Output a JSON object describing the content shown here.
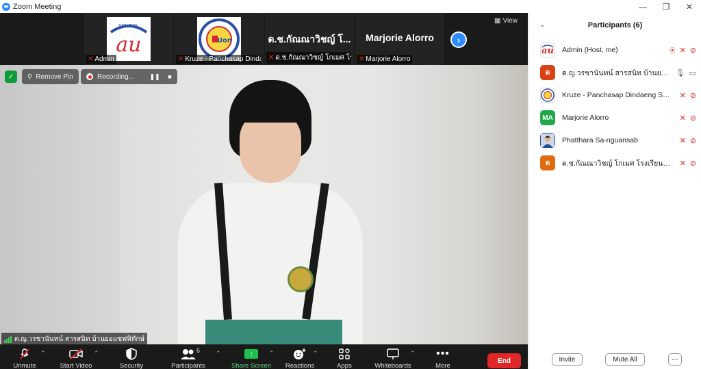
{
  "window": {
    "title": "Zoom Meeting",
    "controls": [
      "—",
      "❐",
      "✕"
    ]
  },
  "strip": {
    "thumbnails": [
      {
        "name": "Admin",
        "logo": "school-logo-au"
      },
      {
        "name": "Kruze - Panchasap Dindaeng School",
        "logo": "school-logo-circle"
      },
      {
        "name": "ด.ช.กัณณาวิชญ์ โกเมศ โรงเรียนดารา",
        "display": "ด.ช.กัณณาวิชญ์ โ..."
      },
      {
        "name": "Marjorie Alorro",
        "display": "Marjorie Alorro"
      }
    ],
    "view_label": "View",
    "logo_text": {
      "school": "SCHOOL",
      "au": "au",
      "circle": "Uon"
    }
  },
  "video": {
    "remove_pin_label": "Remove Pin",
    "recording_label": "Recording...",
    "speaker_name": "ด.ญ.วรชานันทน์ สารสนิท บ้านยอแซฟพิทักษ์"
  },
  "toolbar": {
    "unmute": "Unmute",
    "start_video": "Start Video",
    "security": "Security",
    "participants": "Participants",
    "participants_count": "6",
    "share_screen": "Share Screen",
    "reactions": "Reactions",
    "apps": "Apps",
    "whiteboards": "Whiteboards",
    "more": "More",
    "end": "End"
  },
  "panel": {
    "title": "Participants (6)",
    "participants": [
      {
        "name": "Admin (Host, me)",
        "avatar": "au",
        "avatar_color": "#ffffff"
      },
      {
        "name": "ด.ญ.วรชานันทน์ สารสนิท บ้านยอแซฟพิทักษ์",
        "avatar": "ด",
        "avatar_color": "#d84315"
      },
      {
        "name": "Kruze - Panchasap Dindaeng School",
        "avatar": "",
        "avatar_color": "#ffffff"
      },
      {
        "name": "Marjorie Alorro",
        "avatar": "MA",
        "avatar_color": "#22a84a"
      },
      {
        "name": "Phatthara Sa-nguansab",
        "avatar": "",
        "avatar_color": "#1f4e9a"
      },
      {
        "name": "ด.ช.กัณณาวิชญ์ โกเมศ โรงเรียนดารา",
        "avatar": "ด",
        "avatar_color": "#e06b0e"
      }
    ],
    "invite": "Invite",
    "mute_all": "Mute All",
    "more": "···"
  },
  "colors": {
    "accent": "#2d8cff",
    "end_red": "#e02828",
    "share_green": "#1fbe4e"
  }
}
